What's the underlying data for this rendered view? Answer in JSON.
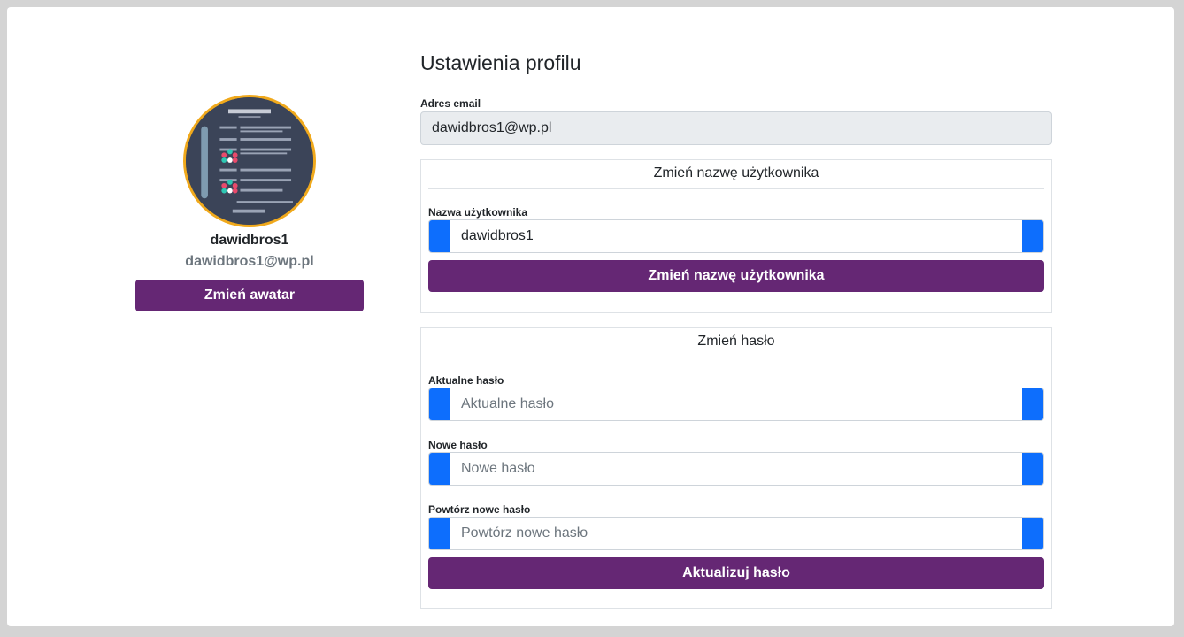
{
  "profile": {
    "username": "dawidbros1",
    "email": "dawidbros1@wp.pl",
    "change_avatar_label": "Zmień awatar",
    "avatar_image": "avatar-poster-image"
  },
  "settings": {
    "title": "Ustawienia profilu",
    "email_label": "Adres email",
    "email_value": "dawidbros1@wp.pl",
    "username_panel": {
      "title": "Zmień nazwę użytkownika",
      "field_label": "Nazwa użytkownika",
      "field_value": "dawidbros1",
      "submit_label": "Zmień nazwę użytkownika"
    },
    "password_panel": {
      "title": "Zmień hasło",
      "current_label": "Aktualne hasło",
      "current_placeholder": "Aktualne hasło",
      "new_label": "Nowe hasło",
      "new_placeholder": "Nowe hasło",
      "repeat_label": "Powtórz nowe hasło",
      "repeat_placeholder": "Powtórz nowe hasło",
      "submit_label": "Aktualizuj hasło"
    }
  },
  "colors": {
    "accent_purple": "#652774",
    "addon_blue": "#0d6efd",
    "avatar_border": "#f0a91c"
  }
}
